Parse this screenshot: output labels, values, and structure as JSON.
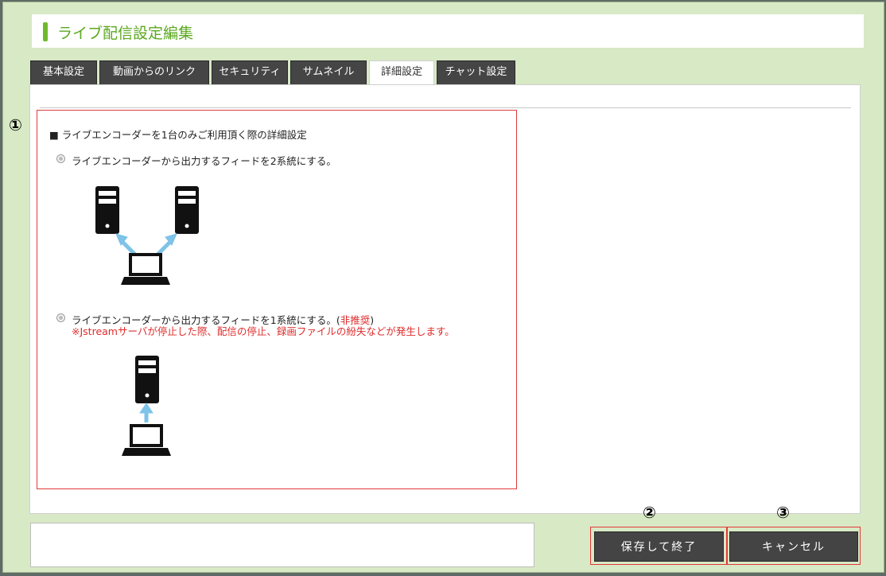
{
  "dialog": {
    "title": "ライブ配信設定編集"
  },
  "tabs": [
    {
      "label": "基本設定"
    },
    {
      "label": "動画からのリンク"
    },
    {
      "label": "セキュリティ"
    },
    {
      "label": "サムネイル"
    },
    {
      "label": "詳細設定"
    },
    {
      "label": "チャット設定"
    }
  ],
  "active_tab": "詳細設定",
  "section": {
    "marker": "①",
    "title": "■ ライブエンコーダーを1台のみご利用頂く際の詳細設定",
    "option1": {
      "label": "ライブエンコーダーから出力するフィードを2系統にする。"
    },
    "option2": {
      "label": "ライブエンコーダーから出力するフィードを1系統にする。(",
      "not_recommended": "非推奨",
      "label_close": ")",
      "warning": "※Jstreamサーバが停止した際、配信の停止、録画ファイルの紛失などが発生します。"
    }
  },
  "buttons": {
    "save_marker": "②",
    "save_label": "保存して終了",
    "cancel_marker": "③",
    "cancel_label": "キャンセル"
  },
  "colors": {
    "accent_green": "#6fba2c",
    "tab_dark": "#454545",
    "button_dark": "#444444",
    "highlight_red": "#e23a3a",
    "arrow_blue": "#7ec3e8"
  },
  "icons": [
    "server-icon",
    "laptop-icon",
    "arrow-icon",
    "radio-icon"
  ]
}
